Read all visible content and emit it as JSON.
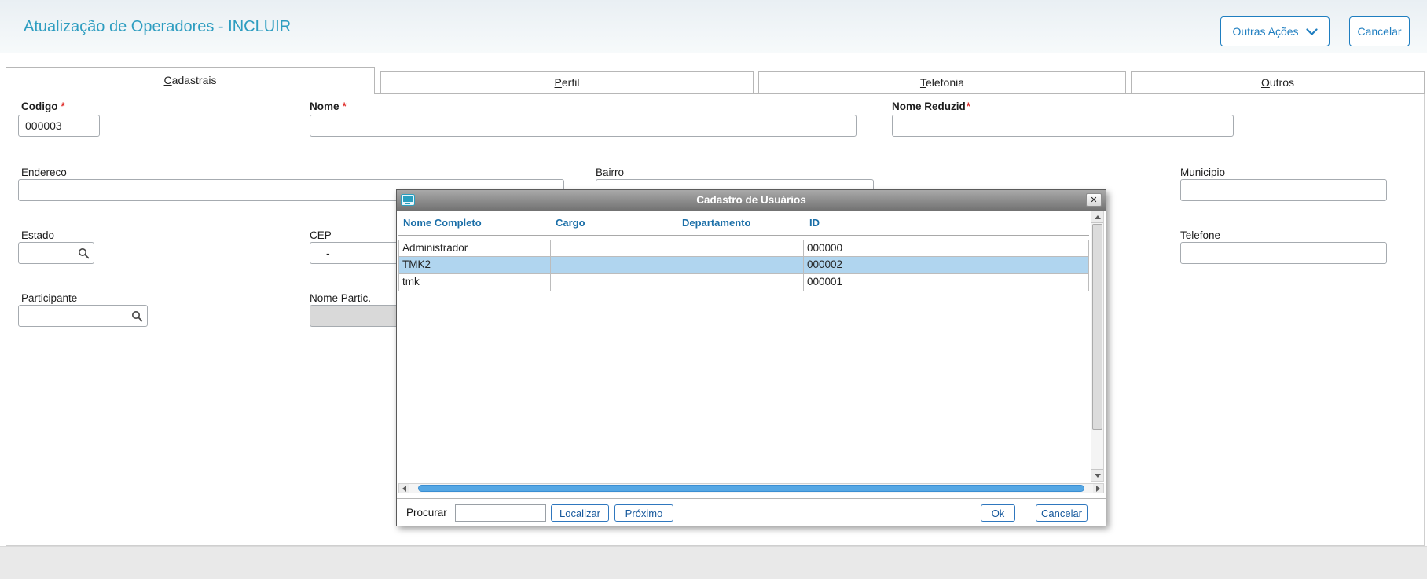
{
  "header": {
    "title": "Atualização de Operadores - INCLUIR",
    "other_actions_label": "Outras Ações",
    "cancel_label": "Cancelar"
  },
  "tabs": [
    {
      "first": "C",
      "rest": "adastrais",
      "active": true
    },
    {
      "first": "P",
      "rest": "erfil",
      "active": false
    },
    {
      "first": "T",
      "rest": "elefonia",
      "active": false
    },
    {
      "first": "O",
      "rest": "utros",
      "active": false
    }
  ],
  "form": {
    "codigo": {
      "label": "Codigo",
      "required": "*",
      "value": "000003"
    },
    "nome": {
      "label": "Nome",
      "required": "*",
      "value": ""
    },
    "nome_reduzido": {
      "label": "Nome Reduzid",
      "required": "*",
      "value": ""
    },
    "endereco": {
      "label": "Endereco",
      "value": ""
    },
    "bairro": {
      "label": "Bairro",
      "value": ""
    },
    "municipio": {
      "label": "Municipio",
      "value": ""
    },
    "estado": {
      "label": "Estado",
      "value": ""
    },
    "cep": {
      "label": "CEP",
      "value": "-"
    },
    "telefone": {
      "label": "Telefone",
      "value": ""
    },
    "participante": {
      "label": "Participante",
      "value": ""
    },
    "nome_partic": {
      "label": "Nome Partic.",
      "value": ""
    }
  },
  "modal": {
    "title": "Cadastro de Usuários",
    "close_glyph": "✕",
    "columns": [
      "Nome Completo",
      "Cargo",
      "Departamento",
      "ID"
    ],
    "rows": [
      {
        "nome_completo": "Administrador",
        "cargo": "",
        "departamento": "",
        "id": "000000"
      },
      {
        "nome_completo": "TMK2",
        "cargo": "",
        "departamento": "",
        "id": "000002"
      },
      {
        "nome_completo": "tmk",
        "cargo": "",
        "departamento": "",
        "id": "000001"
      }
    ],
    "selected_row_index": 1,
    "search": {
      "label": "Procurar",
      "value": ""
    },
    "buttons": {
      "localizar": "Localizar",
      "proximo": "Próximo",
      "ok": "Ok",
      "cancelar": "Cancelar"
    }
  },
  "colors": {
    "accent_blue": "#1f7ec0",
    "title_blue": "#2d9dc0",
    "column_header_blue": "#1b6fa8",
    "selected_row": "#b0d5ef",
    "scroll_thumb_blue": "#55a7e4",
    "required_red": "#e0312e"
  }
}
